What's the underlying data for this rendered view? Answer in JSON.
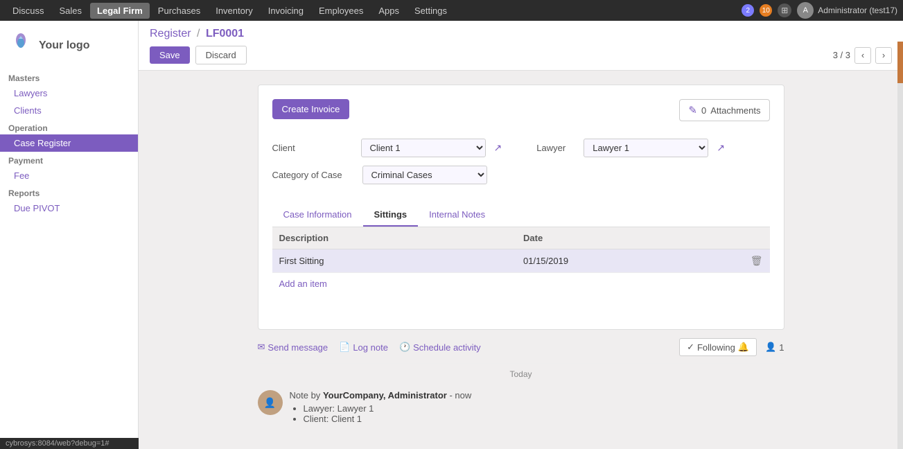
{
  "topNav": {
    "items": [
      {
        "label": "Discuss",
        "active": false
      },
      {
        "label": "Sales",
        "active": false
      },
      {
        "label": "Legal Firm",
        "active": true
      },
      {
        "label": "Purchases",
        "active": false
      },
      {
        "label": "Inventory",
        "active": false
      },
      {
        "label": "Invoicing",
        "active": false
      },
      {
        "label": "Employees",
        "active": false
      },
      {
        "label": "Apps",
        "active": false
      },
      {
        "label": "Settings",
        "active": false
      }
    ],
    "badge1": "2",
    "badge2": "10",
    "user": "Administrator (test17)"
  },
  "sidebar": {
    "logo_text": "Your logo",
    "sections": [
      {
        "title": "Masters",
        "items": [
          {
            "label": "Lawyers",
            "active": false
          },
          {
            "label": "Clients",
            "active": false
          }
        ]
      },
      {
        "title": "Operation",
        "items": [
          {
            "label": "Case Register",
            "active": true
          }
        ]
      },
      {
        "title": "Payment",
        "items": [
          {
            "label": "Fee",
            "active": false
          }
        ]
      },
      {
        "title": "Reports",
        "items": [
          {
            "label": "Due PIVOT",
            "active": false
          }
        ]
      }
    ]
  },
  "breadcrumb": {
    "parent": "Register",
    "separator": "/",
    "current": "LF0001"
  },
  "toolbar": {
    "save_label": "Save",
    "discard_label": "Discard",
    "pagination": "3 / 3"
  },
  "form": {
    "create_invoice_label": "Create Invoice",
    "attachments": {
      "count": "0",
      "label": "Attachments"
    },
    "fields": {
      "client_label": "Client",
      "client_value": "Client 1",
      "lawyer_label": "Lawyer",
      "lawyer_value": "Lawyer 1",
      "category_label": "Category of Case",
      "category_value": "Criminal Cases"
    },
    "tabs": [
      {
        "label": "Case Information",
        "active": false
      },
      {
        "label": "Sittings",
        "active": true
      },
      {
        "label": "Internal Notes",
        "active": false
      }
    ],
    "table": {
      "headers": [
        "Description",
        "Date"
      ],
      "rows": [
        {
          "description": "First Sitting",
          "date": "01/15/2019"
        }
      ],
      "add_item_label": "Add an item"
    }
  },
  "chatter": {
    "send_message_label": "Send message",
    "log_note_label": "Log note",
    "schedule_activity_label": "Schedule activity",
    "following_label": "Following",
    "follower_count": "1",
    "today_label": "Today",
    "note": {
      "author": "YourCompany, Administrator",
      "time": "now",
      "note_by": "Note by",
      "bullet1": "Lawyer: Lawyer 1",
      "bullet2": "Client: Client 1"
    }
  },
  "urlbar": "cybrosys:8084/web?debug=1#"
}
